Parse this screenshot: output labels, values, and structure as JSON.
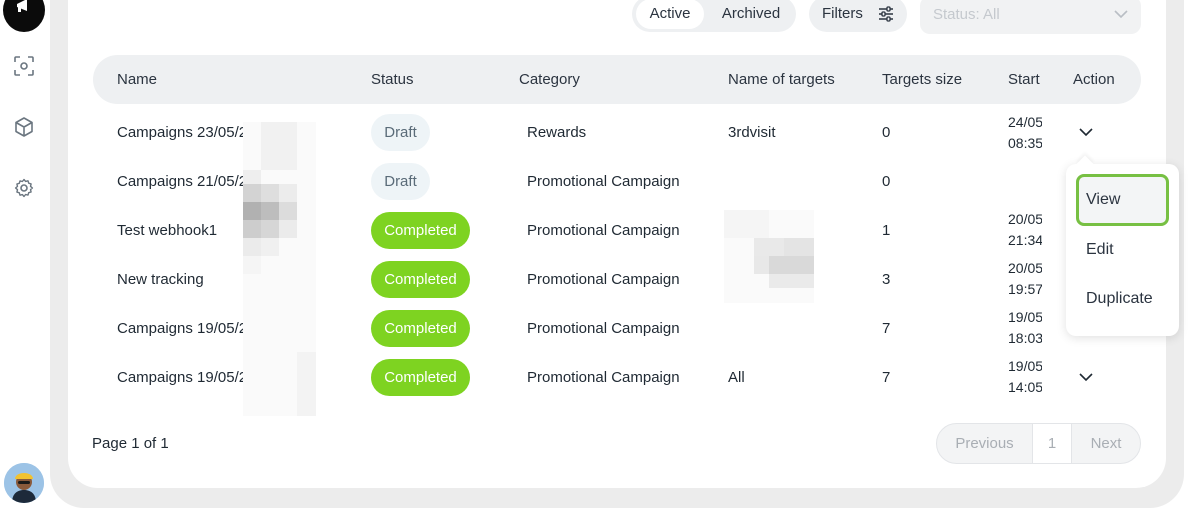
{
  "toolbar": {
    "tabs": [
      "Active",
      "Archived"
    ],
    "active_tab": "Active",
    "filters_label": "Filters",
    "status_placeholder": "Status: All"
  },
  "table": {
    "columns": [
      "Name",
      "Status",
      "Category",
      "Name of targets",
      "Targets size",
      "Start",
      "Action"
    ],
    "rows": [
      {
        "name": "Campaigns 23/05/2",
        "status": "Draft",
        "category": "Rewards",
        "targets": "3rdvisit",
        "size": "0",
        "start_date": "24/05",
        "start_time": "08:35"
      },
      {
        "name": "Campaigns 21/05/2",
        "status": "Draft",
        "category": "Promotional Campaign",
        "targets": "",
        "size": "0",
        "start_date": "",
        "start_time": ""
      },
      {
        "name": "Test webhook1",
        "status": "Completed",
        "category": "Promotional Campaign",
        "targets": "",
        "size": "1",
        "start_date": "20/05",
        "start_time": "21:34"
      },
      {
        "name": "New tracking",
        "status": "Completed",
        "category": "Promotional Campaign",
        "targets": "",
        "size": "3",
        "start_date": "20/05",
        "start_time": "19:57"
      },
      {
        "name": "Campaigns 19/05/2",
        "status": "Completed",
        "category": "Promotional Campaign",
        "targets": "",
        "size": "7",
        "start_date": "19/05",
        "start_time": "18:03"
      },
      {
        "name": "Campaigns 19/05/2",
        "status": "Completed",
        "category": "Promotional Campaign",
        "targets": "All",
        "size": "7",
        "start_date": "19/05",
        "start_time": "14:05"
      }
    ]
  },
  "action_menu": {
    "items": [
      "View",
      "Edit",
      "Duplicate"
    ],
    "selected": "View"
  },
  "footer": {
    "page_info": "Page 1 of 1",
    "prev_label": "Previous",
    "page_number": "1",
    "next_label": "Next"
  },
  "colors": {
    "completed": "#7ed321",
    "draft_bg": "#eef4f7",
    "menu_highlight": "#77c043"
  }
}
